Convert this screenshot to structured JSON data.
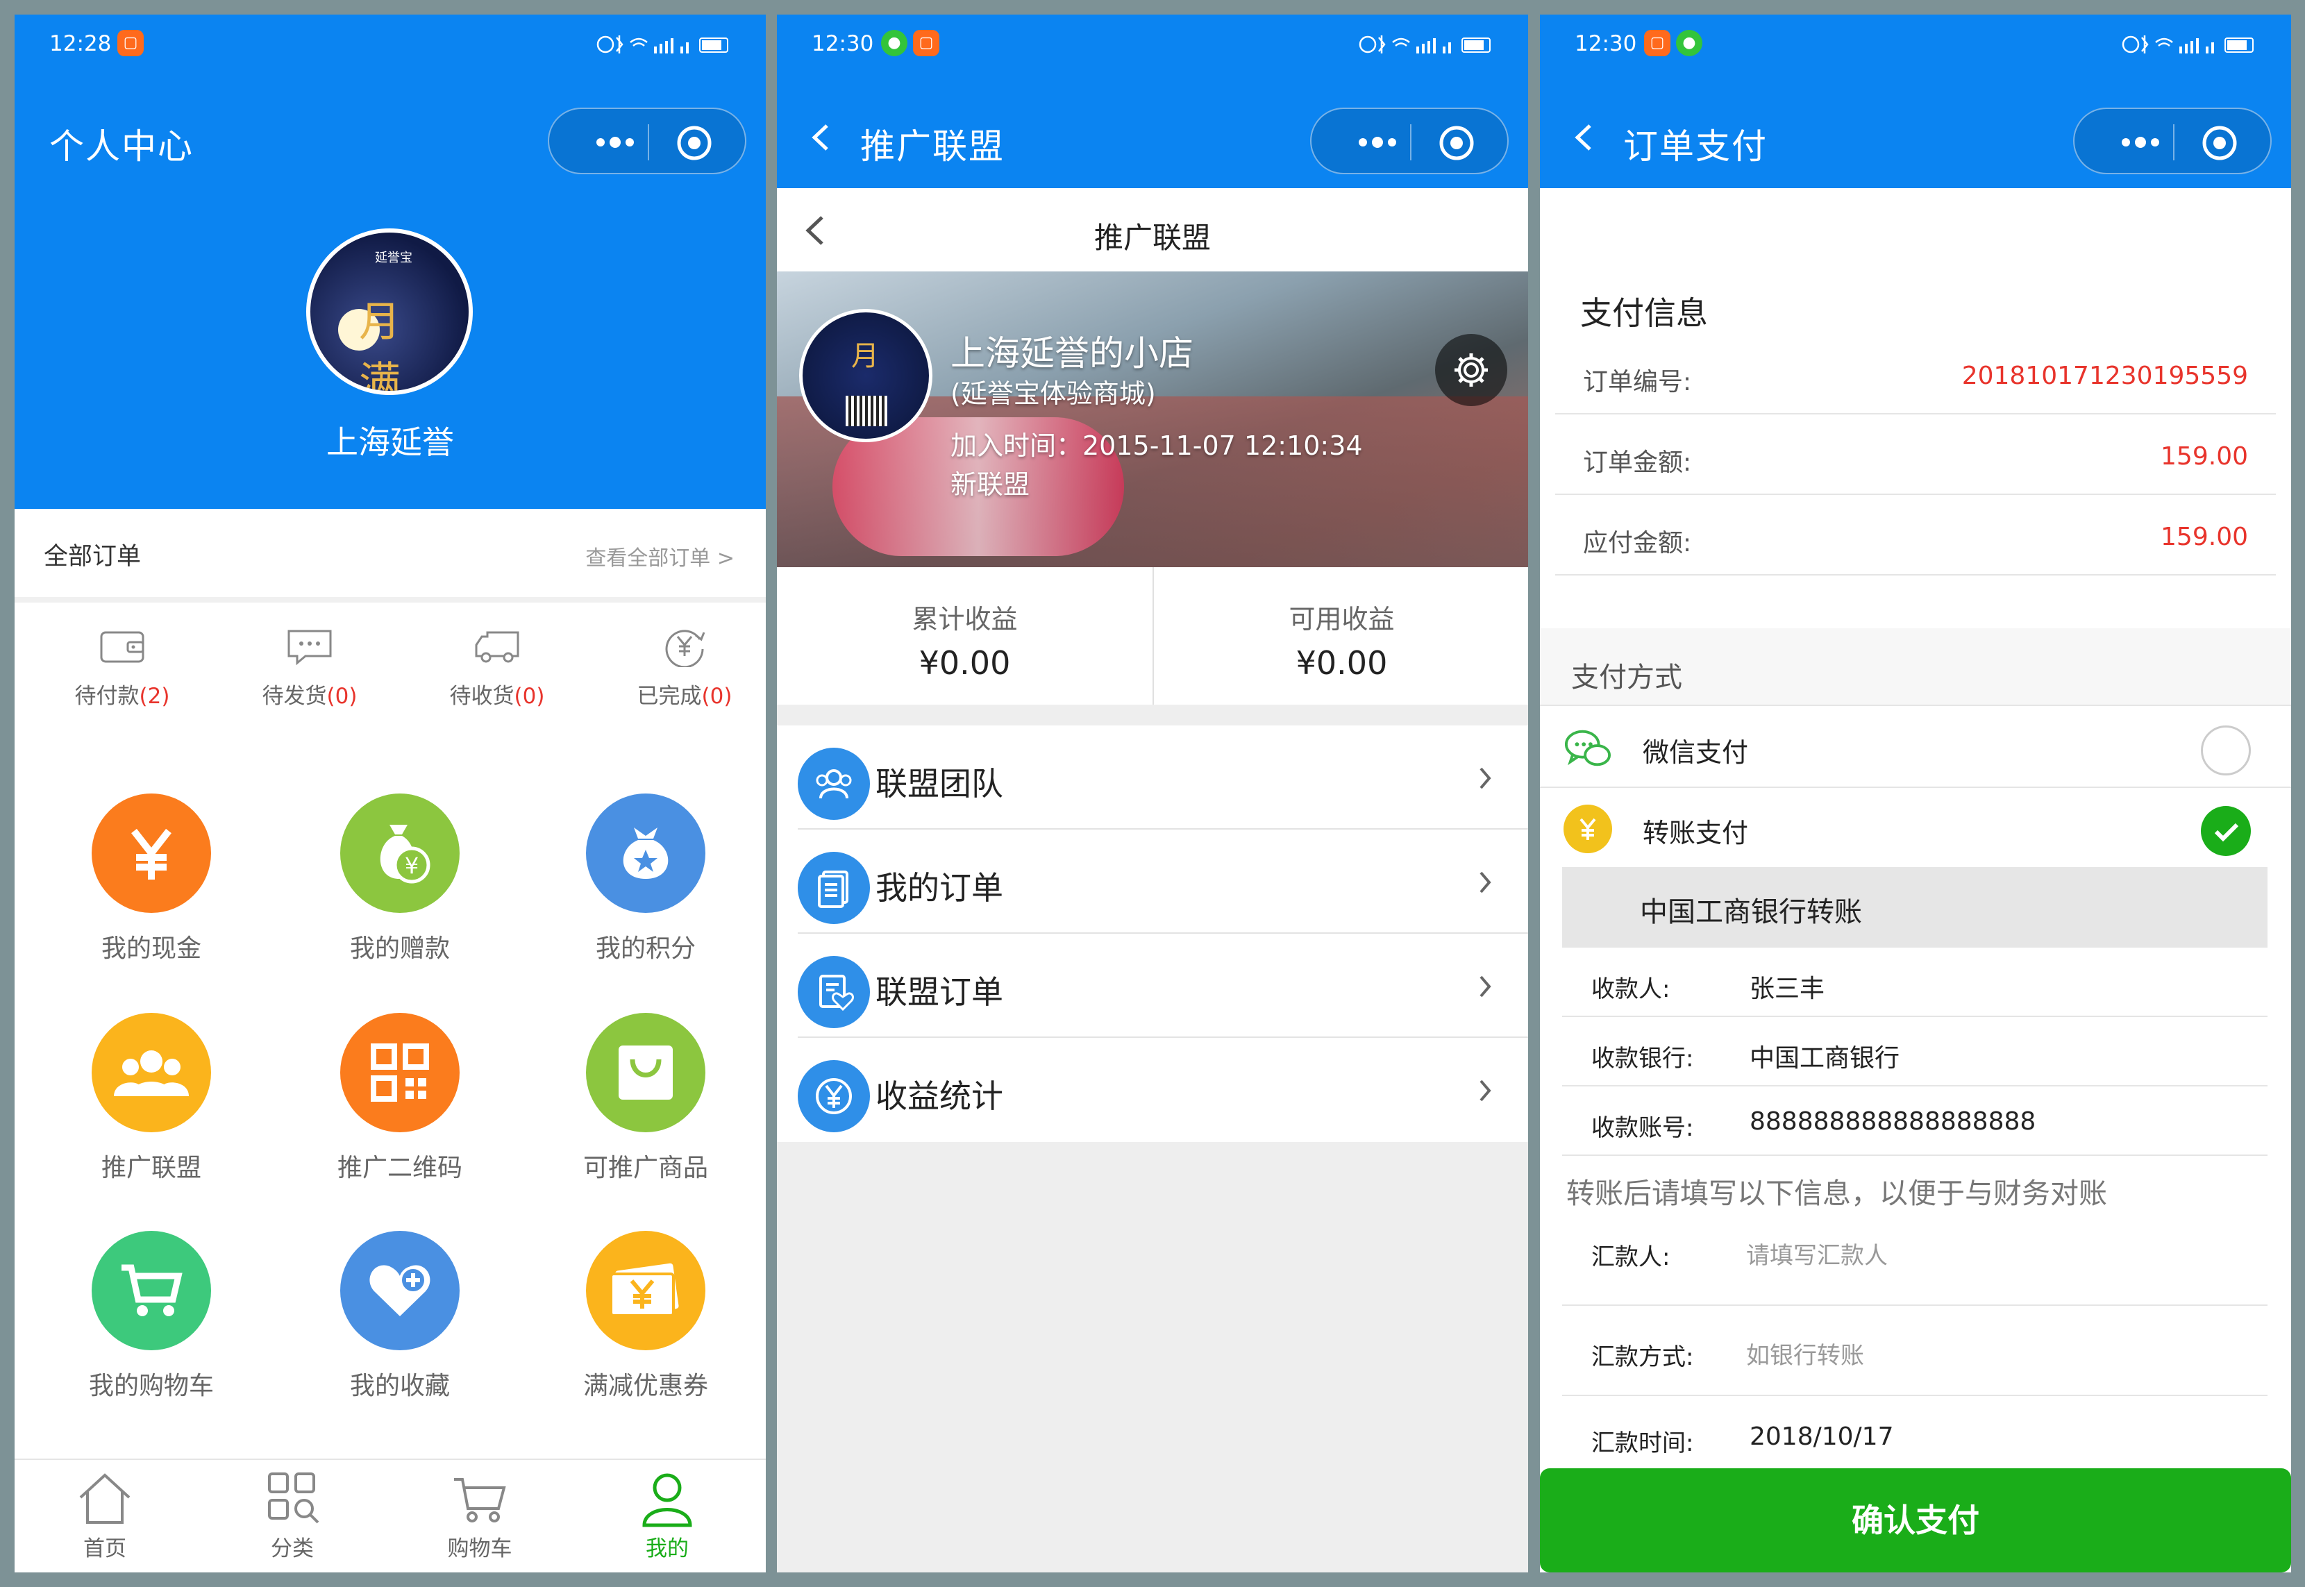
{
  "screens": [
    {
      "status": {
        "time": "12:28"
      },
      "nav": {
        "title": "个人中心"
      },
      "profile": {
        "username": "上海延誉",
        "avatar_logo": "延誉宝"
      },
      "orders": {
        "title": "全部订单",
        "view_all": "查看全部订单 >",
        "statuses": [
          {
            "label": "待付款",
            "count": "(2)",
            "icon": "wallet-icon"
          },
          {
            "label": "待发货",
            "count": "(0)",
            "icon": "message-icon"
          },
          {
            "label": "待收货",
            "count": "(0)",
            "icon": "truck-icon"
          },
          {
            "label": "已完成",
            "count": "(0)",
            "icon": "yen-refresh-icon"
          }
        ]
      },
      "grid": [
        {
          "label": "我的现金",
          "icon": "yen-icon",
          "color": "#fb7c1d"
        },
        {
          "label": "我的赠款",
          "icon": "money-bag-icon",
          "color": "#8cc63f"
        },
        {
          "label": "我的积分",
          "icon": "star-bag-icon",
          "color": "#4a90e2"
        },
        {
          "label": "推广联盟",
          "icon": "users-icon",
          "color": "#fbb41c"
        },
        {
          "label": "推广二维码",
          "icon": "qrcode-icon",
          "color": "#fb7c1d"
        },
        {
          "label": "可推广商品",
          "icon": "shopping-bag-icon",
          "color": "#8cc63f"
        },
        {
          "label": "我的购物车",
          "icon": "cart-icon",
          "color": "#3dc97c"
        },
        {
          "label": "我的收藏",
          "icon": "heart-plus-icon",
          "color": "#4a90e2"
        },
        {
          "label": "满减优惠券",
          "icon": "coupon-icon",
          "color": "#fbb41c"
        }
      ],
      "tabs": [
        {
          "label": "首页",
          "icon": "home-icon"
        },
        {
          "label": "分类",
          "icon": "category-icon"
        },
        {
          "label": "购物车",
          "icon": "cart-icon"
        },
        {
          "label": "我的",
          "icon": "user-icon",
          "active": true
        }
      ]
    },
    {
      "status": {
        "time": "12:30"
      },
      "nav": {
        "title": "推广联盟"
      },
      "subheader": {
        "title": "推广联盟"
      },
      "banner": {
        "shop_name": "上海延誉的小店",
        "shop_sub": "(延誉宝体验商城)",
        "join_time": "加入时间：2015-11-07 12:10:34",
        "member_type": "新联盟"
      },
      "earnings": [
        {
          "label": "累计收益",
          "value": "¥0.00"
        },
        {
          "label": "可用收益",
          "value": "¥0.00"
        }
      ],
      "menu": [
        {
          "label": "联盟团队",
          "icon": "team-icon"
        },
        {
          "label": "我的订单",
          "icon": "orders-icon"
        },
        {
          "label": "联盟订单",
          "icon": "alliance-order-icon"
        },
        {
          "label": "收益统计",
          "icon": "yen-circle-icon"
        }
      ]
    },
    {
      "status": {
        "time": "12:30"
      },
      "nav": {
        "title": "订单支付"
      },
      "payment_info": {
        "title": "支付信息",
        "rows": [
          {
            "label": "订单编号:",
            "value": "201810171230195559"
          },
          {
            "label": "订单金额:",
            "value": "159.00"
          },
          {
            "label": "应付金额:",
            "value": "159.00"
          }
        ]
      },
      "methods": {
        "title": "支付方式",
        "items": [
          {
            "label": "微信支付",
            "icon": "wechat-icon",
            "selected": false
          },
          {
            "label": "转账支付",
            "icon": "yen-icon",
            "selected": true
          }
        ]
      },
      "bank": {
        "title": "中国工商银行转账",
        "rows": [
          {
            "label": "收款人:",
            "value": "张三丰"
          },
          {
            "label": "收款银行:",
            "value": "中国工商银行"
          },
          {
            "label": "收款账号:",
            "value": "888888888888888888"
          }
        ]
      },
      "note": "转账后请填写以下信息，以便于与财务对账",
      "remit": {
        "payer_label": "汇款人:",
        "payer_placeholder": "请填写汇款人",
        "method_label": "汇款方式:",
        "method_placeholder": "如银行转账",
        "time_label": "汇款时间:",
        "time_value": "2018/10/17"
      },
      "confirm_label": "确认支付"
    }
  ]
}
